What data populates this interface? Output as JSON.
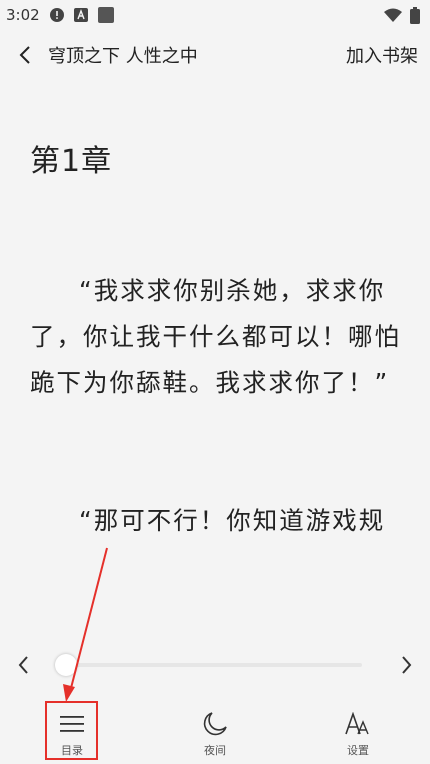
{
  "status_bar": {
    "time": "3:02",
    "icons": [
      "alert-circle-icon",
      "text-a-icon",
      "square-app-icon",
      "wifi-icon",
      "battery-icon"
    ]
  },
  "header": {
    "back_icon": "chevron-left-icon",
    "book_title": "穹顶之下 人性之中",
    "add_to_bookshelf": "加入书架"
  },
  "reader": {
    "chapter_title": "第1章",
    "paragraphs": [
      "“我求求你别杀她，求求你了，你让我干什么都可以！哪怕跪下为你舔鞋。我求求你了！”",
      "“那可不行！你知道游戏规"
    ]
  },
  "progress": {
    "prev_icon": "chevron-left-icon",
    "next_icon": "chevron-right-icon",
    "value": 0.0
  },
  "bottom_nav": {
    "items": [
      {
        "label": "目录",
        "icon": "menu-list-icon"
      },
      {
        "label": "夜间",
        "icon": "moon-icon"
      },
      {
        "label": "设置",
        "icon": "font-settings-icon"
      }
    ]
  },
  "annotation": {
    "color": "#e5302a",
    "target": "目录"
  }
}
